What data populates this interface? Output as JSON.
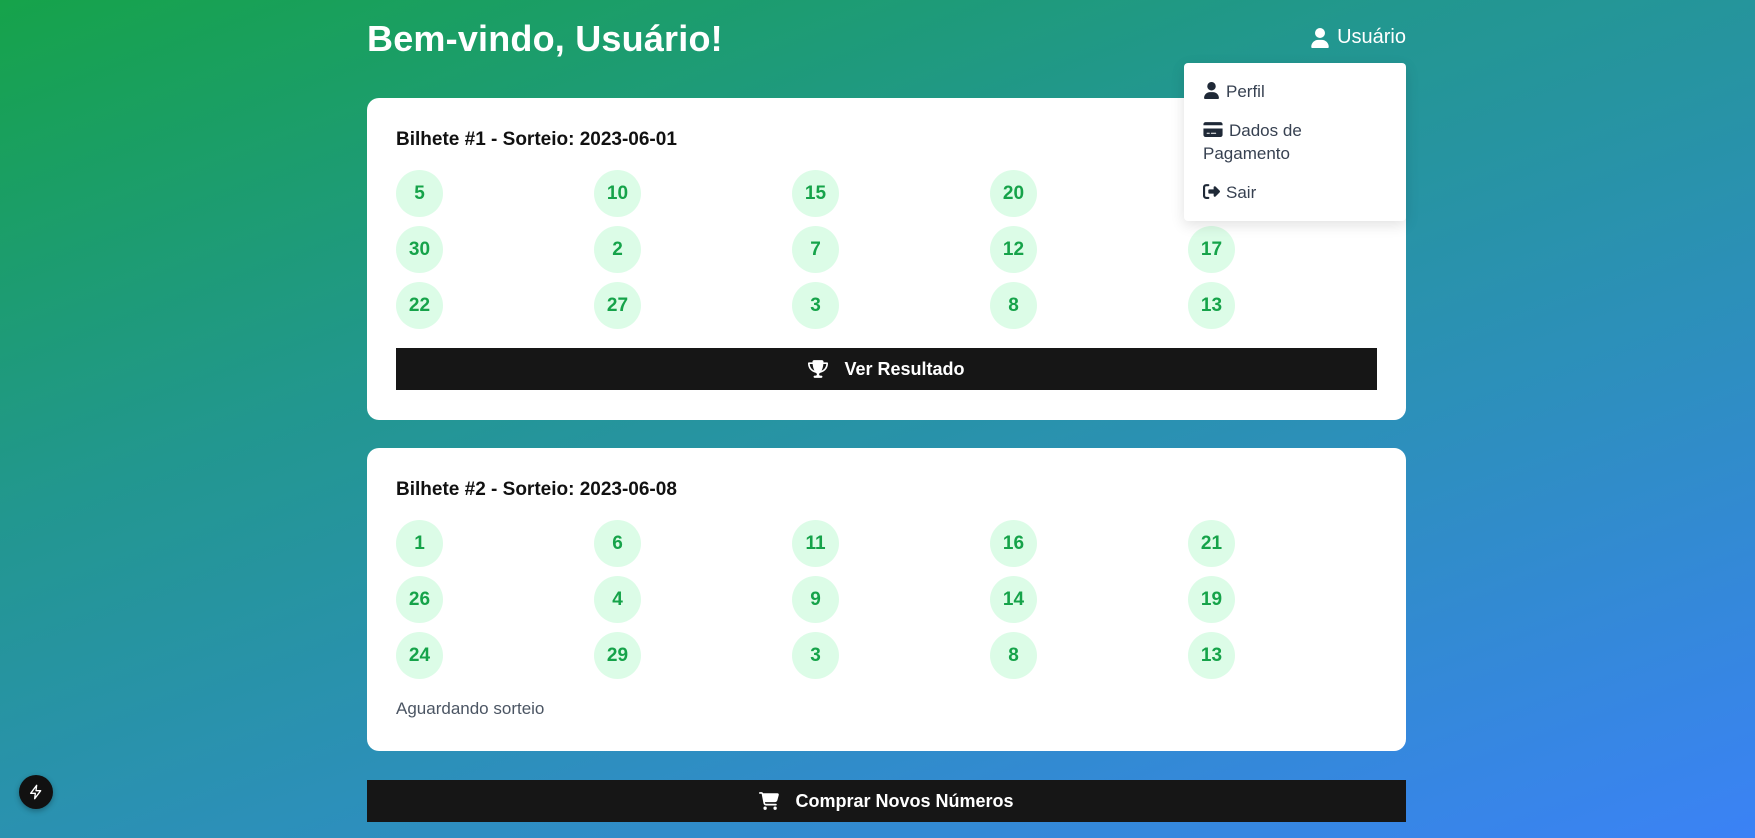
{
  "header": {
    "title": "Bem-vindo, Usuário!",
    "user_label": "Usuário"
  },
  "user_dropdown": {
    "items": [
      {
        "label": "Perfil",
        "icon": "user-icon"
      },
      {
        "label": "Dados de Pagamento",
        "icon": "credit-card-icon"
      },
      {
        "label": "Sair",
        "icon": "sign-out-icon"
      }
    ]
  },
  "tickets": [
    {
      "title": "Bilhete #1 - Sorteio: 2023-06-01",
      "numbers": [
        "5",
        "10",
        "15",
        "20",
        "",
        "30",
        "2",
        "7",
        "12",
        "17",
        "22",
        "27",
        "3",
        "8",
        "13"
      ],
      "action_label": "Ver Resultado",
      "action_icon": "trophy-icon"
    },
    {
      "title": "Bilhete #2 - Sorteio: 2023-06-08",
      "numbers": [
        "1",
        "6",
        "11",
        "16",
        "21",
        "26",
        "4",
        "9",
        "14",
        "19",
        "24",
        "29",
        "3",
        "8",
        "13"
      ],
      "status": "Aguardando sorteio"
    }
  ],
  "buy_button": {
    "label": "Comprar Novos Números",
    "icon": "cart-icon"
  },
  "colors": {
    "ball_background": "#dcfce7",
    "ball_text": "#16a34a",
    "button_background": "#161616"
  }
}
